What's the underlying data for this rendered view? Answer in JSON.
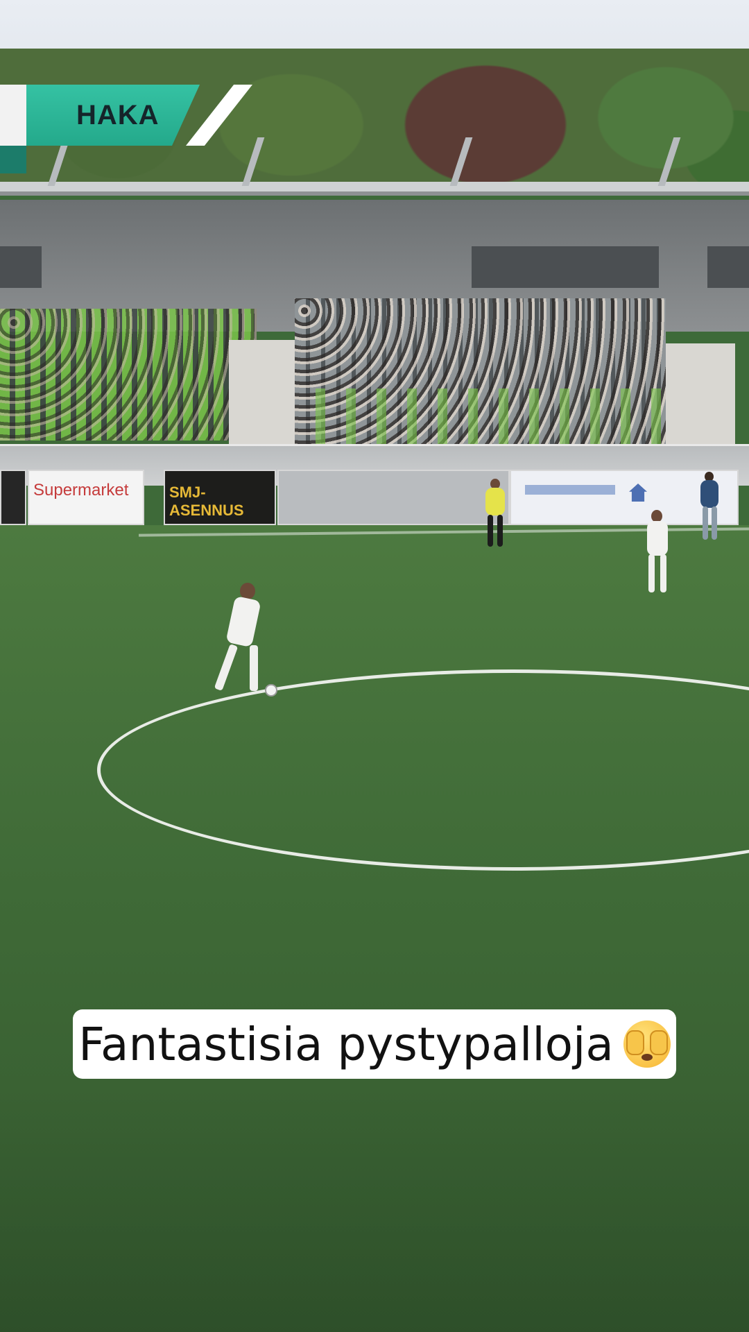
{
  "scorebug": {
    "team_name": "HAKA",
    "team_color": "#2bb597"
  },
  "ads": {
    "board1": "Supermarket",
    "board2": "SMJ-ASENNUS"
  },
  "caption": {
    "text": "Fantastisia pystypalloja",
    "emoji": "face-with-open-eyes-and-hand-over-mouth-icon"
  }
}
